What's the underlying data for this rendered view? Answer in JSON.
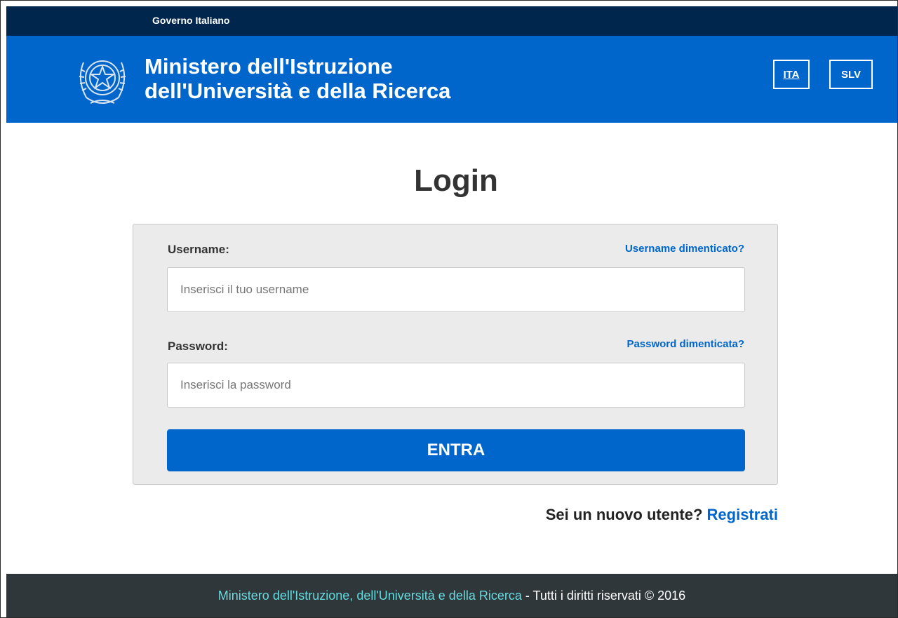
{
  "gov_bar": {
    "text": "Governo Italiano"
  },
  "header": {
    "title_line1": "Ministero dell'Istruzione",
    "title_line2": "dell'Università e della Ricerca",
    "emblem_icon": "italian-republic-emblem-icon",
    "languages": [
      "ITA",
      "SLV"
    ],
    "active_language": "ITA",
    "brand_color": "#0066cc",
    "gov_bar_color": "#00264d"
  },
  "login": {
    "title": "Login",
    "username_label": "Username:",
    "username_forgot": "Username dimenticato?",
    "username_placeholder": "Inserisci il tuo username",
    "username_value": "",
    "password_label": "Password:",
    "password_forgot": "Password dimenticata?",
    "password_placeholder": "Inserisci la password",
    "password_value": "",
    "submit_label": "ENTRA"
  },
  "register": {
    "prompt": "Sei un nuovo utente?",
    "link": "Registrati"
  },
  "footer": {
    "link_text": "Ministero dell'Istruzione, dell'Università e della Ricerca",
    "suffix": " - Tutti i diritti riservati © 2016",
    "background_color": "#30373b",
    "link_color": "#65dcdf"
  }
}
